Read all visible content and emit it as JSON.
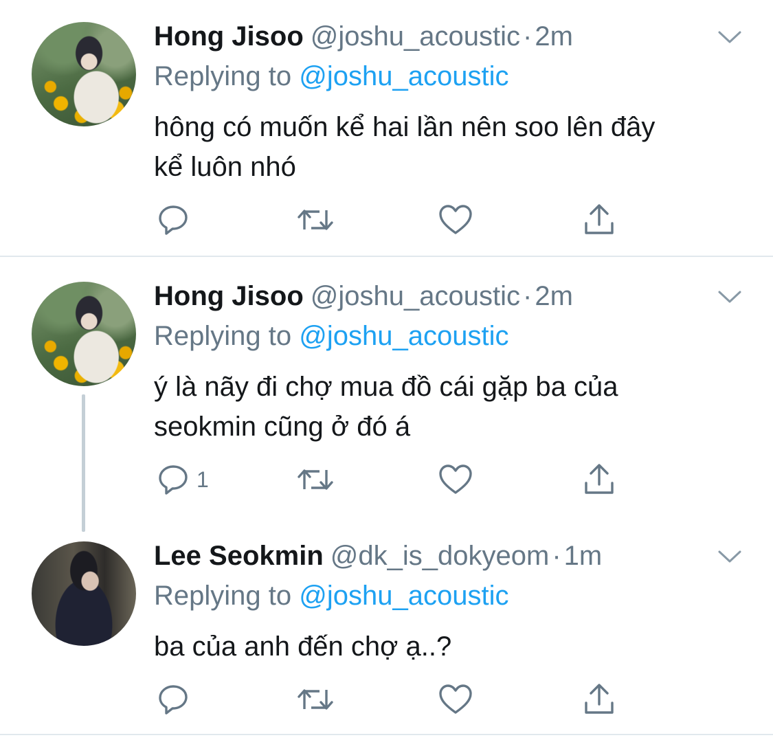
{
  "tweets": [
    {
      "name": "Hong Jisoo",
      "handle": "@joshu_acoustic",
      "dot": "·",
      "time": "2m",
      "replying_prefix": "Replying to",
      "replying_to": "@joshu_acoustic",
      "text_lines": [
        "hông có muốn kể hai lần nên soo lên đây",
        "kể luôn nhó"
      ],
      "reply_count": ""
    },
    {
      "name": "Hong Jisoo",
      "handle": "@joshu_acoustic",
      "dot": "·",
      "time": "2m",
      "replying_prefix": "Replying to",
      "replying_to": "@joshu_acoustic",
      "text_lines": [
        "ý là nãy đi chợ mua đồ cái gặp ba của",
        "seokmin cũng ở đó á"
      ],
      "reply_count": "1"
    },
    {
      "name": "Lee Seokmin",
      "handle": "@dk_is_dokyeom",
      "dot": "·",
      "time": "1m",
      "replying_prefix": "Replying to",
      "replying_to": "@joshu_acoustic",
      "text_lines": [
        "ba của anh đến chợ ạ..?"
      ],
      "reply_count": ""
    }
  ],
  "icons": {
    "reply": "reply-icon",
    "retweet": "retweet-icon",
    "like": "heart-icon",
    "share": "share-icon",
    "more": "chevron-down-icon"
  },
  "colors": {
    "link": "#1da1f2",
    "secondary": "#657786",
    "icon": "#657786",
    "divider": "#e1e8ed",
    "thread": "#c4cfd6"
  }
}
